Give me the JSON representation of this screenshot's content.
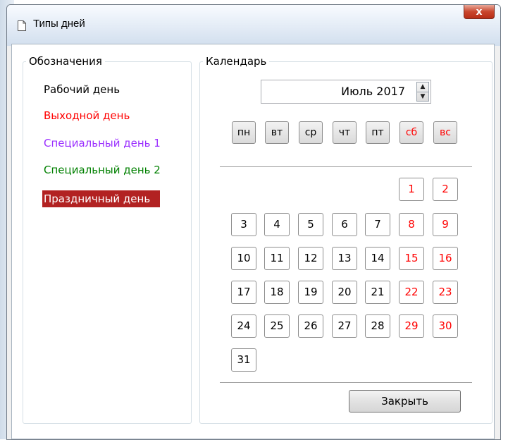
{
  "window": {
    "title": "Типы дней",
    "close_glyph": "x"
  },
  "legend": {
    "title": "Обозначения",
    "items": [
      {
        "label": "Рабочий день",
        "color": "#000000",
        "background": ""
      },
      {
        "label": "Выходной день",
        "color": "#ff0000",
        "background": ""
      },
      {
        "label": "Специальный день 1",
        "color": "#9b30ff",
        "background": ""
      },
      {
        "label": "Специальный день 2",
        "color": "#008000",
        "background": ""
      },
      {
        "label": "Праздничный день",
        "color": "#ffffff",
        "background": "#b22222"
      }
    ]
  },
  "calendar": {
    "title": "Календарь",
    "month_label": "Июль 2017",
    "weekdays": [
      {
        "label": "пн",
        "weekend": false
      },
      {
        "label": "вт",
        "weekend": false
      },
      {
        "label": "ср",
        "weekend": false
      },
      {
        "label": "чт",
        "weekend": false
      },
      {
        "label": "пт",
        "weekend": false
      },
      {
        "label": "сб",
        "weekend": true
      },
      {
        "label": "вс",
        "weekend": true
      }
    ],
    "first_weekday_index": 5,
    "days_in_month": 31,
    "weekend_color": "#ff0000",
    "workday_color": "#000000"
  },
  "buttons": {
    "close_label": "Закрыть"
  }
}
